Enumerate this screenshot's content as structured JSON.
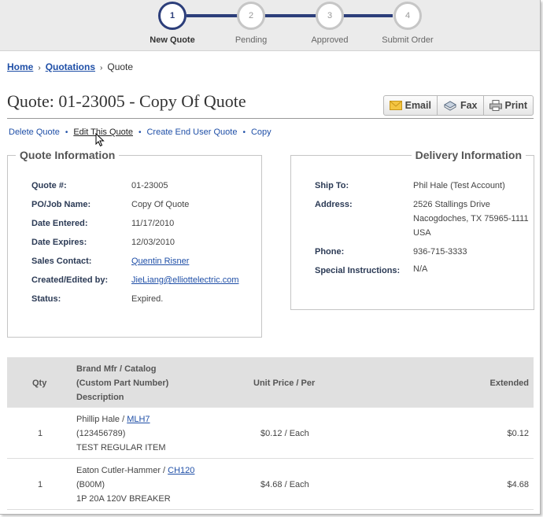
{
  "stepper": {
    "steps": [
      {
        "num": "1",
        "label": "New Quote"
      },
      {
        "num": "2",
        "label": "Pending"
      },
      {
        "num": "3",
        "label": "Approved"
      },
      {
        "num": "4",
        "label": "Submit Order"
      }
    ]
  },
  "breadcrumb": {
    "home": "Home",
    "quotations": "Quotations",
    "current": "Quote",
    "sep": "›"
  },
  "page": {
    "title": "Quote: 01-23005 - Copy Of Quote"
  },
  "actions": {
    "email": "Email",
    "fax": "Fax",
    "print": "Print"
  },
  "links": {
    "delete": "Delete Quote",
    "edit": "Edit This Quote",
    "create_end_user": "Create End User Quote",
    "copy": "Copy",
    "sep": "•"
  },
  "quote_info": {
    "title": "Quote Information",
    "rows": [
      {
        "label": "Quote #:",
        "value": "01-23005"
      },
      {
        "label": "PO/Job Name:",
        "value": "Copy Of Quote"
      },
      {
        "label": "Date Entered:",
        "value": "11/17/2010"
      },
      {
        "label": "Date Expires:",
        "value": "12/03/2010"
      },
      {
        "label": "Sales Contact:",
        "value": "Quentin Risner"
      },
      {
        "label": "Created/Edited by:",
        "value": "JieLiang@elliottelectric.com"
      },
      {
        "label": "Status:",
        "value": "Expired."
      }
    ]
  },
  "delivery_info": {
    "title": "Delivery Information",
    "ship_to_label": "Ship To:",
    "ship_to": "Phil Hale (Test Account)",
    "address_label": "Address:",
    "address_line1": "2526 Stallings Drive",
    "address_line2": "Nacogdoches, TX 75965-1111",
    "address_line3": "USA",
    "phone_label": "Phone:",
    "phone": "936-715-3333",
    "special_label": "Special Instructions:",
    "special": "N/A"
  },
  "table": {
    "headers": {
      "qty": "Qty",
      "brand_line1": "Brand Mfr / Catalog",
      "brand_line2": "(Custom Part Number)",
      "brand_line3": "Description",
      "unit_price": "Unit Price / Per",
      "extended": "Extended"
    },
    "rows": [
      {
        "qty": "1",
        "brand": "Phillip Hale / ",
        "catalog": "MLH7",
        "custom": "(123456789)",
        "desc": "TEST REGULAR ITEM",
        "unit": "$0.12 / Each",
        "extended": "$0.12"
      },
      {
        "qty": "1",
        "brand": "Eaton Cutler-Hammer / ",
        "catalog": "CH120",
        "custom": "(B00M)",
        "desc": "1P 20A 120V BREAKER",
        "unit": "$4.68 / Each",
        "extended": "$4.68"
      }
    ]
  }
}
